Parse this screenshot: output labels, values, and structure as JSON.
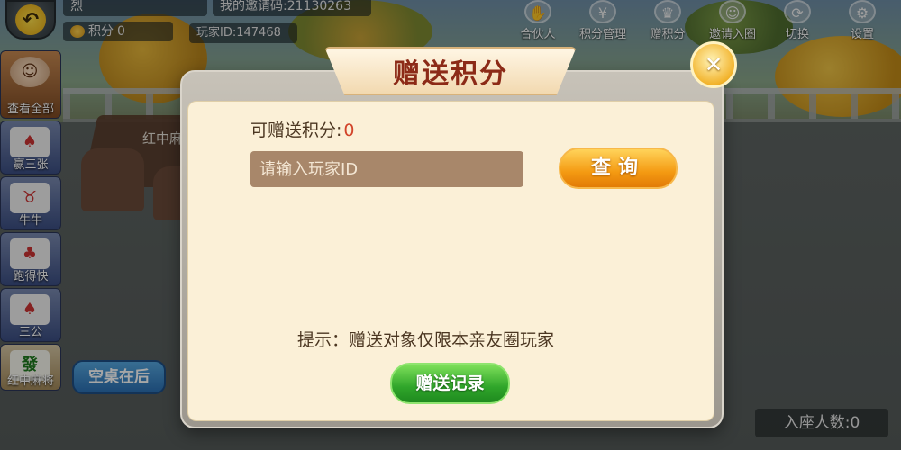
{
  "header": {
    "player_name": "烈",
    "score_label": "积分",
    "score_value": "0",
    "invite_code_label": "我的邀请码:",
    "invite_code_value": "21130263",
    "player_id_label": "玩家ID:",
    "player_id_value": "147468",
    "icons": [
      {
        "icon": "handshake-icon",
        "label": "合伙人"
      },
      {
        "icon": "yen-icon",
        "label": "积分管理"
      },
      {
        "icon": "trophy-icon",
        "label": "赠积分"
      },
      {
        "icon": "add-user-icon",
        "label": "邀请入圈"
      },
      {
        "icon": "switch-icon",
        "label": "切换"
      },
      {
        "icon": "gear-icon",
        "label": "设置"
      }
    ]
  },
  "left_list": [
    {
      "label": "查看全部"
    },
    {
      "label": "赢三张"
    },
    {
      "label": "牛牛"
    },
    {
      "label": "跑得快"
    },
    {
      "label": "三公"
    },
    {
      "label": "红中麻将",
      "glyph": "發"
    }
  ],
  "room_label": "红中麻",
  "empty_first_button": "空桌在后",
  "seated_label": "入座人数:0",
  "modal": {
    "title": "赠送积分",
    "giftable_label": "可赠送积分:",
    "giftable_value": "0",
    "id_placeholder": "请输入玩家ID",
    "query_button": "查询",
    "hint": "提示：赠送对象仅限本亲友圈玩家",
    "records_button": "赠送记录",
    "close_symbol": "✕"
  }
}
